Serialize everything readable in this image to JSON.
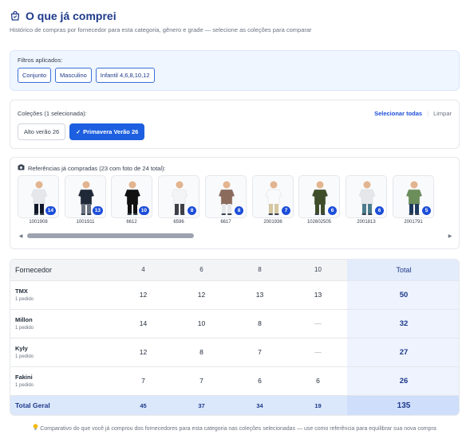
{
  "header": {
    "title": "O que já comprei",
    "subtitle": "Histórico de compras por fornecedor para esta categoria, gênero e grade — selecione as coleções para comparar"
  },
  "filters": {
    "label": "Filtros aplicados:",
    "chips": [
      "Conjunto",
      "Masculino",
      "Infantil 4,6,8,10,12"
    ]
  },
  "collections": {
    "label": "Coleções (1 selecionada):",
    "select_all": "Selecionar todas",
    "separator": "|",
    "clear": "Limpar",
    "options": [
      {
        "label": "Alto verão 26",
        "selected": false
      },
      {
        "label": "Primavera Verão 26",
        "selected": true,
        "check": "✓"
      }
    ]
  },
  "references": {
    "heading": "Referências já compradas (23 com foto de 24 total):",
    "items": [
      {
        "code": "1001908",
        "count": "14",
        "shirt": "#e5e7eb",
        "pants": "#111827"
      },
      {
        "code": "1001911",
        "count": "13",
        "shirt": "#1f2937",
        "pants": "#6b7280"
      },
      {
        "code": "6612",
        "count": "10",
        "shirt": "#111111",
        "pants": "#111111"
      },
      {
        "code": "6596",
        "count": "8",
        "shirt": "#f3f4f6",
        "pants": "#3f3f46"
      },
      {
        "code": "6617",
        "count": "8",
        "shirt": "#8b6b5c",
        "pants": "#e5e7eb"
      },
      {
        "code": "2001936",
        "count": "7",
        "shirt": "#f9fafb",
        "pants": "#d6c7a1"
      },
      {
        "code": "102602505",
        "count": "6",
        "shirt": "#3f4d2a",
        "pants": "#3f4d2a"
      },
      {
        "code": "2001813",
        "count": "6",
        "shirt": "#e5e7eb",
        "pants": "#4b7a8c"
      },
      {
        "code": "2001791",
        "count": "5",
        "shirt": "#6b8e5a",
        "pants": "#1e3a5f"
      }
    ],
    "scroll": {
      "left": "◀",
      "right": "▶",
      "thumb_fraction": 0.4
    }
  },
  "table": {
    "header": {
      "supplier": "Fornecedor",
      "sizes": [
        "4",
        "6",
        "8",
        "10"
      ],
      "total": "Total"
    },
    "rows": [
      {
        "name": "TMX",
        "sub": "1 pedido",
        "values": [
          "12",
          "12",
          "13",
          "13"
        ],
        "total": "50"
      },
      {
        "name": "Millon",
        "sub": "1 pedido",
        "values": [
          "14",
          "10",
          "8",
          "—"
        ],
        "total": "32"
      },
      {
        "name": "Kyly",
        "sub": "1 pedido",
        "values": [
          "12",
          "8",
          "7",
          "—"
        ],
        "total": "27"
      },
      {
        "name": "Fakini",
        "sub": "1 pedido",
        "values": [
          "7",
          "7",
          "6",
          "6"
        ],
        "total": "26"
      }
    ],
    "footer": {
      "label": "Total Geral",
      "values": [
        "45",
        "37",
        "34",
        "19"
      ],
      "total": "135"
    }
  },
  "footnote": {
    "icon": "lightbulb-icon",
    "text": "Comparativo do que você já comprou dos fornecedores para esta categoria nas coleções selecionadas — use como referência para equilibrar sua nova compra"
  },
  "colors": {
    "accent": "#1d4ed8",
    "title": "#1e3a8a",
    "filter_bg": "#eff6ff",
    "total_bg": "#eef3fd"
  }
}
